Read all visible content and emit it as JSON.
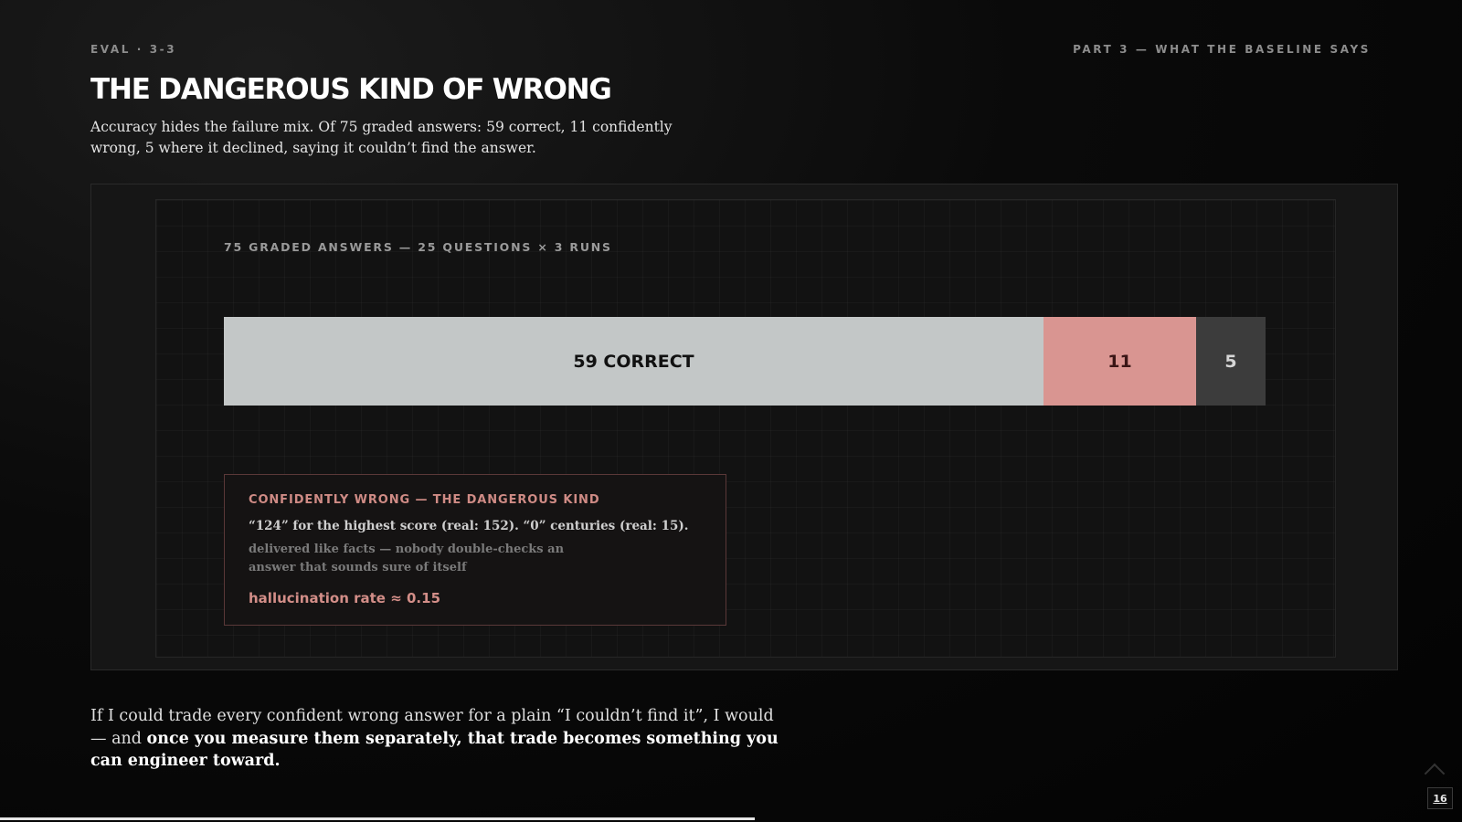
{
  "header": {
    "eyebrow_left": "EVAL · 3-3",
    "eyebrow_right": "PART 3 — WHAT THE BASELINE SAYS",
    "title": "THE DANGEROUS KIND OF WRONG",
    "subtitle": "Accuracy hides the failure mix. Of 75 graded answers: 59 correct, 11 confidently wrong, 5 where it declined, saying it couldn’t find the answer."
  },
  "chart_data": {
    "type": "bar",
    "orientation": "horizontal-stacked",
    "title": "75 GRADED ANSWERS — 25 QUESTIONS × 3 RUNS",
    "total": 75,
    "segments": [
      {
        "key": "correct",
        "value": 59,
        "label": "59 CORRECT",
        "color": "#c3c7c7"
      },
      {
        "key": "wrong",
        "value": 11,
        "label": "11",
        "color": "#d99591"
      },
      {
        "key": "declined",
        "value": 5,
        "label": "5",
        "color": "#3c3c3c"
      }
    ],
    "grid": true
  },
  "callout": {
    "heading": "CONFIDENTLY WRONG — THE DANGEROUS KIND",
    "examples": "“124” for the highest score (real: 152). “0” centuries (real: 15).",
    "note": "delivered like facts — nobody double-checks an answer that sounds sure of itself",
    "rate": "hallucination rate ≈ 0.15",
    "accent_color": "#d38e88"
  },
  "footer": {
    "lead": "If I could trade every confident wrong answer for a plain “I couldn’t find it”, I would — and ",
    "emphasis": "once you measure them separately, that trade becomes something you can engineer toward."
  },
  "page": {
    "number": "16",
    "progress": 0.516
  }
}
